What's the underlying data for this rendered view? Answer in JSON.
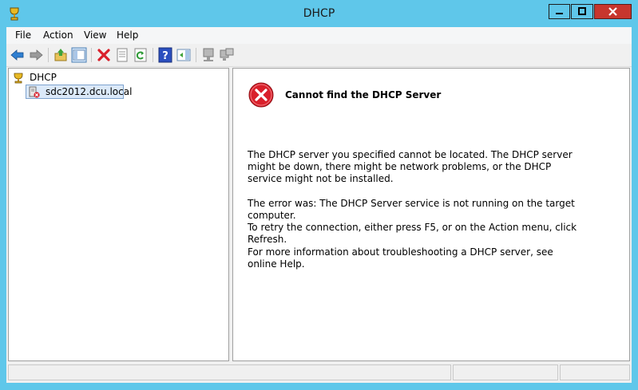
{
  "window": {
    "title": "DHCP",
    "minimize_label": "Minimize",
    "maximize_label": "Maximize",
    "close_label": "Close"
  },
  "menu": {
    "items": [
      "File",
      "Action",
      "View",
      "Help"
    ]
  },
  "toolbar": {
    "buttons": [
      "back-icon",
      "forward-icon",
      "up-folder-icon",
      "show-hide-tree-icon",
      "delete-icon",
      "properties-icon",
      "refresh-icon",
      "help-icon",
      "action-pane-icon",
      "server-icon",
      "server-add-icon"
    ]
  },
  "tree": {
    "root_label": "DHCP",
    "child_label": "sdc2012.dcu.local"
  },
  "error": {
    "heading": "Cannot find the DHCP Server",
    "p1": "The DHCP server you specified cannot be located. The DHCP server might be down, there might be network problems, or the DHCP service might not be installed.",
    "p2": "The error was:  The DHCP Server service is not running on the target computer.",
    "p3": "To retry the connection, either press F5, or on the Action menu, click Refresh.",
    "p4": "For more information about troubleshooting a DHCP server, see online Help."
  },
  "colors": {
    "frame": "#5fc7ea",
    "close": "#c7362d",
    "error_red": "#d9202b",
    "selection": "#dbe9f9"
  }
}
